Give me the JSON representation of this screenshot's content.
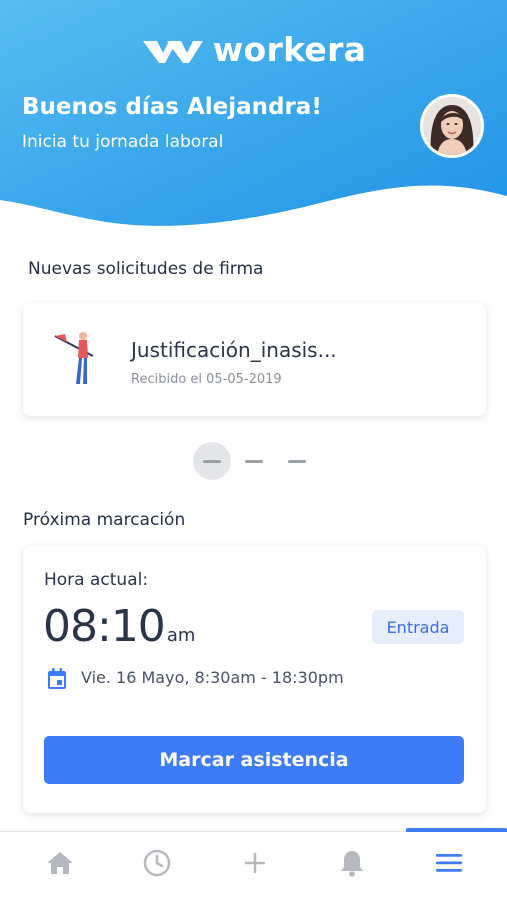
{
  "app": {
    "logo_text": "workera"
  },
  "header": {
    "greeting": "Buenos días Alejandra!",
    "subtitle": "Inicia tu jornada laboral"
  },
  "signature_requests": {
    "title": "Nuevas solicitudes de firma",
    "items": [
      {
        "name": "Justificación_inasis...",
        "received": "Recibido el 05-05-2019"
      }
    ]
  },
  "next_clock": {
    "title": "Próxima marcación",
    "current_time_label": "Hora actual:",
    "time": "08:10",
    "period": "am",
    "type_badge": "Entrada",
    "schedule": "Vie. 16 Mayo, 8:30am - 18:30pm",
    "button_label": "Marcar asistencia"
  },
  "bottom_nav": {
    "items": [
      {
        "icon": "home-icon"
      },
      {
        "icon": "clock-icon"
      },
      {
        "icon": "plus-icon"
      },
      {
        "icon": "bell-icon"
      },
      {
        "icon": "menu-icon",
        "active": true
      }
    ]
  },
  "colors": {
    "header_gradient_start": "#4fb8ef",
    "header_gradient_end": "#2496e8",
    "accent": "#3d7bf7",
    "badge_bg": "#e6edfd"
  }
}
